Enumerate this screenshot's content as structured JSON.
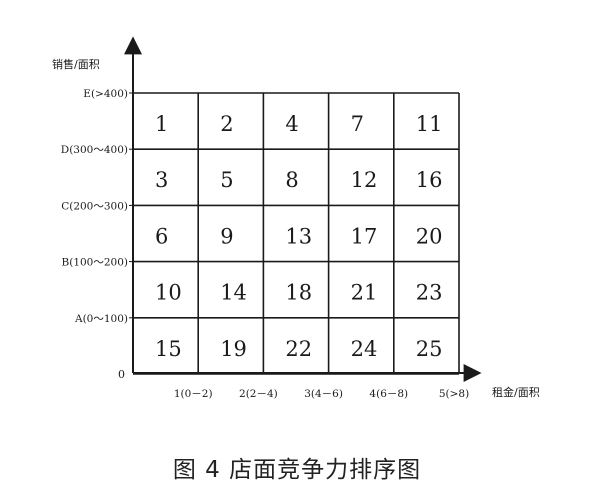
{
  "diagram": {
    "y_axis_title": "销售/面积",
    "x_axis_title": "租金/面积",
    "origin_label": "0",
    "y_labels": [
      "A(0～100)",
      "B(100～200)",
      "C(200～300)",
      "D(300～400)",
      "E(>400)"
    ],
    "x_labels": [
      "1(0－2)",
      "2(2－4)",
      "3(4－6)",
      "4(6－8)",
      "5(>8)"
    ],
    "rows": [
      [
        "1",
        "2",
        "4",
        "7",
        "11"
      ],
      [
        "3",
        "5",
        "8",
        "12",
        "16"
      ],
      [
        "6",
        "9",
        "13",
        "17",
        "20"
      ],
      [
        "10",
        "14",
        "18",
        "21",
        "23"
      ],
      [
        "15",
        "19",
        "22",
        "24",
        "25"
      ]
    ]
  },
  "caption": "图 4 店面竞争力排序图"
}
